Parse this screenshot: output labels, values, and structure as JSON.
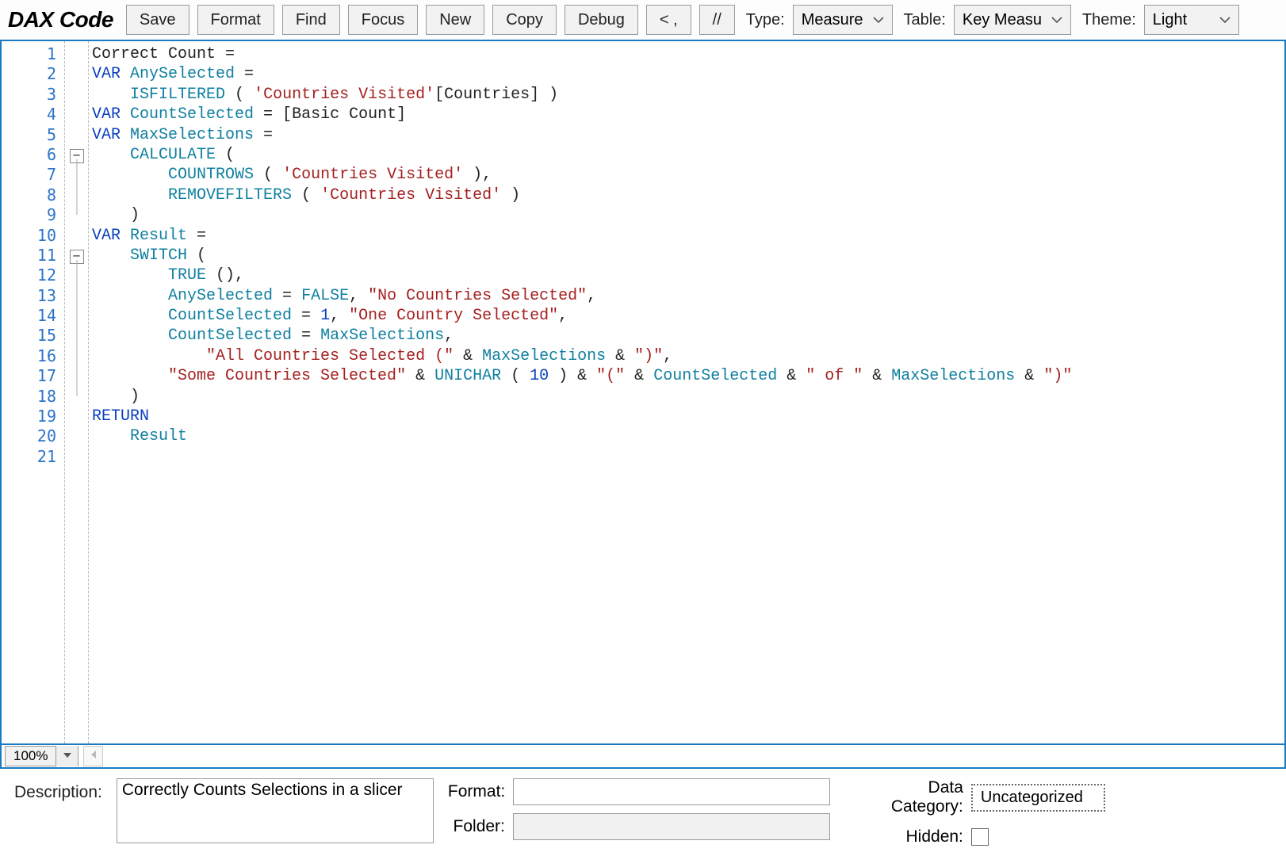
{
  "app_title": "DAX Code",
  "toolbar": {
    "save": "Save",
    "format": "Format",
    "find": "Find",
    "focus": "Focus",
    "new": "New",
    "copy": "Copy",
    "debug": "Debug",
    "comma": "< ,",
    "comment": "//",
    "type_label": "Type:",
    "type_value": "Measure",
    "table_label": "Table:",
    "table_value": "Key Measu",
    "theme_label": "Theme:",
    "theme_value": "Light"
  },
  "line_count": 21,
  "fold_points": [
    6,
    11
  ],
  "code_lines": [
    [
      [
        "name",
        "Correct Count "
      ],
      [
        "punc",
        "="
      ]
    ],
    [
      [
        "kw",
        "VAR "
      ],
      [
        "id",
        "AnySelected "
      ],
      [
        "punc",
        "="
      ]
    ],
    [
      [
        "name",
        "    "
      ],
      [
        "fn",
        "ISFILTERED "
      ],
      [
        "punc",
        "( "
      ],
      [
        "str",
        "'Countries Visited'"
      ],
      [
        "punc",
        "["
      ],
      [
        "name",
        "Countries"
      ],
      [
        "punc",
        "] )"
      ]
    ],
    [
      [
        "kw",
        "VAR "
      ],
      [
        "id",
        "CountSelected "
      ],
      [
        "punc",
        "= ["
      ],
      [
        "name",
        "Basic Count"
      ],
      [
        "punc",
        "]"
      ]
    ],
    [
      [
        "kw",
        "VAR "
      ],
      [
        "id",
        "MaxSelections "
      ],
      [
        "punc",
        "="
      ]
    ],
    [
      [
        "name",
        "    "
      ],
      [
        "fn",
        "CALCULATE "
      ],
      [
        "punc",
        "("
      ]
    ],
    [
      [
        "name",
        "        "
      ],
      [
        "fn",
        "COUNTROWS "
      ],
      [
        "punc",
        "( "
      ],
      [
        "str",
        "'Countries Visited'"
      ],
      [
        "punc",
        " ),"
      ]
    ],
    [
      [
        "name",
        "        "
      ],
      [
        "fn",
        "REMOVEFILTERS "
      ],
      [
        "punc",
        "( "
      ],
      [
        "str",
        "'Countries Visited'"
      ],
      [
        "punc",
        " )"
      ]
    ],
    [
      [
        "name",
        "    "
      ],
      [
        "punc",
        ")"
      ]
    ],
    [
      [
        "kw",
        "VAR "
      ],
      [
        "id",
        "Result "
      ],
      [
        "punc",
        "="
      ]
    ],
    [
      [
        "name",
        "    "
      ],
      [
        "fn",
        "SWITCH "
      ],
      [
        "punc",
        "("
      ]
    ],
    [
      [
        "name",
        "        "
      ],
      [
        "fn",
        "TRUE "
      ],
      [
        "punc",
        "(),"
      ]
    ],
    [
      [
        "name",
        "        "
      ],
      [
        "id",
        "AnySelected "
      ],
      [
        "punc",
        "= "
      ],
      [
        "fn",
        "FALSE"
      ],
      [
        "punc",
        ", "
      ],
      [
        "str",
        "\"No Countries Selected\""
      ],
      [
        "punc",
        ","
      ]
    ],
    [
      [
        "name",
        "        "
      ],
      [
        "id",
        "CountSelected "
      ],
      [
        "punc",
        "= "
      ],
      [
        "num",
        "1"
      ],
      [
        "punc",
        ", "
      ],
      [
        "str",
        "\"One Country Selected\""
      ],
      [
        "punc",
        ","
      ]
    ],
    [
      [
        "name",
        "        "
      ],
      [
        "id",
        "CountSelected "
      ],
      [
        "punc",
        "= "
      ],
      [
        "id",
        "MaxSelections"
      ],
      [
        "punc",
        ","
      ]
    ],
    [
      [
        "name",
        "            "
      ],
      [
        "str",
        "\"All Countries Selected (\""
      ],
      [
        "punc",
        " & "
      ],
      [
        "id",
        "MaxSelections"
      ],
      [
        "punc",
        " & "
      ],
      [
        "str",
        "\")\""
      ],
      [
        "punc",
        ","
      ]
    ],
    [
      [
        "name",
        "        "
      ],
      [
        "str",
        "\"Some Countries Selected\""
      ],
      [
        "punc",
        " & "
      ],
      [
        "fn",
        "UNICHAR "
      ],
      [
        "punc",
        "( "
      ],
      [
        "num",
        "10"
      ],
      [
        "punc",
        " ) & "
      ],
      [
        "str",
        "\"(\""
      ],
      [
        "punc",
        " & "
      ],
      [
        "id",
        "CountSelected"
      ],
      [
        "punc",
        " & "
      ],
      [
        "str",
        "\" of \""
      ],
      [
        "punc",
        " & "
      ],
      [
        "id",
        "MaxSelections"
      ],
      [
        "punc",
        " & "
      ],
      [
        "str",
        "\")\""
      ]
    ],
    [
      [
        "name",
        "    "
      ],
      [
        "punc",
        ")"
      ]
    ],
    [
      [
        "kw",
        "RETURN"
      ]
    ],
    [
      [
        "name",
        "    "
      ],
      [
        "id",
        "Result"
      ]
    ],
    [
      [
        "name",
        " "
      ]
    ]
  ],
  "zoom": "100%",
  "bottom": {
    "description_label": "Description:",
    "description_value": "Correctly Counts Selections in a slicer",
    "format_label": "Format:",
    "format_value": "",
    "folder_label": "Folder:",
    "folder_value": "",
    "datacat_label": "Data Category:",
    "datacat_value": "Uncategorized",
    "hidden_label": "Hidden:"
  }
}
